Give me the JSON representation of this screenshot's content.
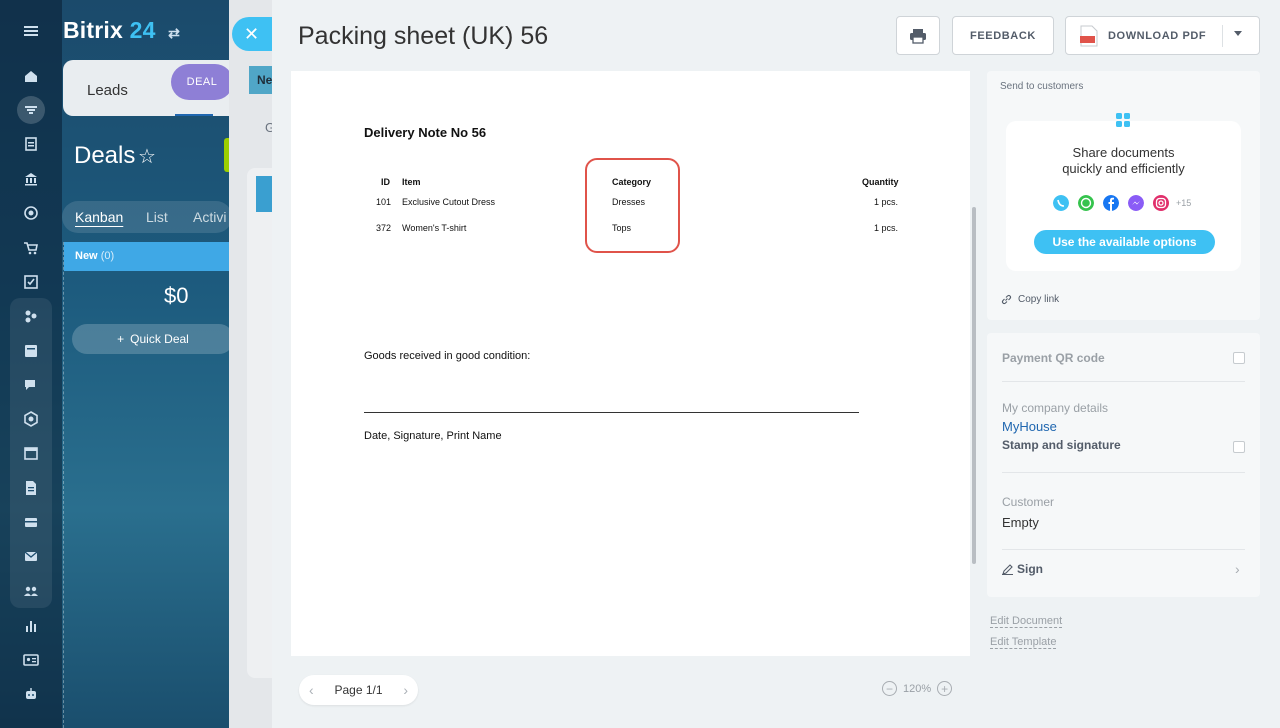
{
  "app": {
    "brand_name": "Bitrix",
    "brand_number": "24",
    "crm_tabs": {
      "leads": "Leads",
      "deal": "DEAL"
    },
    "page_title": "Deals",
    "view_tabs": [
      "Kanban",
      "List",
      "Activi"
    ],
    "kanban": {
      "stage": "New",
      "count": "(0)",
      "sum": "$0",
      "quick_deal": "Quick Deal"
    },
    "back_panel": {
      "tab_fragment": "Ne",
      "text_fragment": "G"
    }
  },
  "panel": {
    "title": "Packing sheet (UK) 56",
    "feedback_label": "FEEDBACK",
    "download_label": "DOWNLOAD PDF",
    "pdf_badge": "PDF"
  },
  "document": {
    "heading": "Delivery Note No 56",
    "columns": {
      "id": "ID",
      "item": "Item",
      "category": "Category",
      "quantity": "Quantity"
    },
    "rows": [
      {
        "id": "101",
        "item": "Exclusive Cutout Dress",
        "category": "Dresses",
        "quantity": "1 pcs."
      },
      {
        "id": "372",
        "item": "Women's T-shirt",
        "category": "Tops",
        "quantity": "1 pcs."
      }
    ],
    "goods_received": "Goods received in good condition:",
    "signature_line": "Date, Signature, Print Name"
  },
  "viewer": {
    "page_label": "Page 1/1",
    "zoom": "120%"
  },
  "send": {
    "label": "Send to customers",
    "share_text_line1": "Share documents",
    "share_text_line2": "quickly and efficiently",
    "more_count": "+15",
    "options_button": "Use the available options",
    "copy_link": "Copy link"
  },
  "settings": {
    "payment_qr": "Payment QR code",
    "company_details": "My company details",
    "company_name": "MyHouse",
    "stamp_signature": "Stamp and signature",
    "customer_label": "Customer",
    "customer_value": "Empty",
    "sign_label": "Sign"
  },
  "edit_links": {
    "document": "Edit Document",
    "template": "Edit Template"
  },
  "colors": {
    "accent": "#3ec1f3",
    "highlight": "#e0534a",
    "link": "#2067b0",
    "deal_tab": "#8e7fd6",
    "kanban_header": "#3fa8e6"
  },
  "icons": {
    "rail": [
      "hamburger-icon",
      "home-icon",
      "filter-icon",
      "tasks-icon",
      "bank-icon",
      "target-icon",
      "cart-icon",
      "checkbox-icon",
      "share-icon",
      "feed-icon",
      "chat-icon",
      "hexagon-icon",
      "calendar-icon",
      "document-icon",
      "store-icon",
      "mail-icon",
      "users-icon",
      "analytics-icon",
      "contact-card-icon",
      "robot-icon"
    ],
    "share": [
      "viber-icon",
      "whatsapp-icon",
      "facebook-icon",
      "messenger-icon",
      "instagram-icon"
    ]
  }
}
